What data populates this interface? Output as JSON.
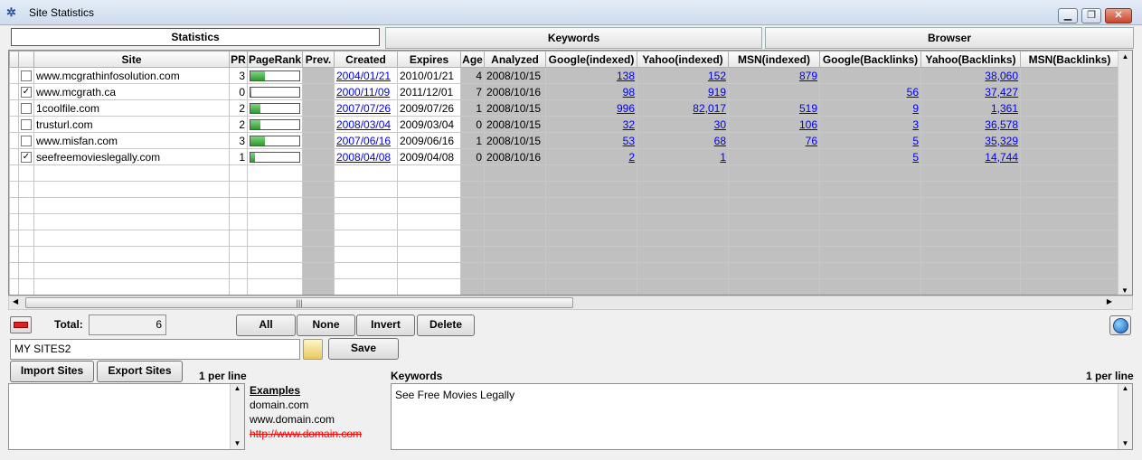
{
  "window": {
    "title": "Site Statistics",
    "minimize": "▁",
    "maximize": "❐",
    "close": "✕"
  },
  "tabs": [
    {
      "label": "Statistics"
    },
    {
      "label": "Keywords"
    },
    {
      "label": "Browser"
    }
  ],
  "grid": {
    "columns": [
      "Site",
      "PR",
      "PageRank",
      "Prev.",
      "Created",
      "Expires",
      "Age",
      "Analyzed",
      "Google(indexed)",
      "Yahoo(indexed)",
      "MSN(indexed)",
      "Google(Backlinks)",
      "Yahoo(Backlinks)",
      "MSN(Backlinks)"
    ],
    "rows": [
      {
        "checked": false,
        "site": "www.mcgrathinfosolution.com",
        "pr": "3",
        "pagerank": 0.3,
        "created": "2004/01/21",
        "expires": "2010/01/21",
        "age": "4",
        "analyzed": "2008/10/15",
        "google_indexed": "138",
        "yahoo_indexed": "152",
        "msn_indexed": "879",
        "google_backlinks": "",
        "yahoo_backlinks": "38,060",
        "msn_backlinks": ""
      },
      {
        "checked": true,
        "site": "www.mcgrath.ca",
        "pr": "0",
        "pagerank": 0.0,
        "created": "2000/11/09",
        "expires": "2011/12/01",
        "age": "7",
        "analyzed": "2008/10/16",
        "google_indexed": "98",
        "yahoo_indexed": "919",
        "msn_indexed": "",
        "google_backlinks": "56",
        "yahoo_backlinks": "37,427",
        "msn_backlinks": ""
      },
      {
        "checked": false,
        "site": "1coolfile.com",
        "pr": "2",
        "pagerank": 0.2,
        "created": "2007/07/26",
        "expires": "2009/07/26",
        "age": "1",
        "analyzed": "2008/10/15",
        "google_indexed": "996",
        "yahoo_indexed": "82,017",
        "msn_indexed": "519",
        "google_backlinks": "9",
        "yahoo_backlinks": "1,361",
        "msn_backlinks": ""
      },
      {
        "checked": false,
        "site": "trusturl.com",
        "pr": "2",
        "pagerank": 0.2,
        "created": "2008/03/04",
        "expires": "2009/03/04",
        "age": "0",
        "analyzed": "2008/10/15",
        "google_indexed": "32",
        "yahoo_indexed": "30",
        "msn_indexed": "106",
        "google_backlinks": "3",
        "yahoo_backlinks": "36,578",
        "msn_backlinks": ""
      },
      {
        "checked": false,
        "site": "www.misfan.com",
        "pr": "3",
        "pagerank": 0.3,
        "created": "2007/06/16",
        "expires": "2009/06/16",
        "age": "1",
        "analyzed": "2008/10/15",
        "google_indexed": "53",
        "yahoo_indexed": "68",
        "msn_indexed": "76",
        "google_backlinks": "5",
        "yahoo_backlinks": "35,329",
        "msn_backlinks": ""
      },
      {
        "checked": true,
        "site": "seefreemovieslegally.com",
        "pr": "1",
        "pagerank": 0.1,
        "created": "2008/04/08",
        "expires": "2009/04/08",
        "age": "0",
        "analyzed": "2008/10/16",
        "google_indexed": "2",
        "yahoo_indexed": "1",
        "msn_indexed": "",
        "google_backlinks": "5",
        "yahoo_backlinks": "14,744",
        "msn_backlinks": ""
      }
    ],
    "empty_rows": 8,
    "hscroll_grip": "|||",
    "scroll_up": "▲",
    "scroll_down": "▼",
    "scroll_left": "◀",
    "scroll_right": "▶"
  },
  "controls": {
    "total_label": "Total:",
    "total_value": "6",
    "buttons": {
      "all": "All",
      "none": "None",
      "invert": "Invert",
      "delete": "Delete",
      "save": "Save",
      "import": "Import Sites",
      "export": "Export Sites"
    },
    "list_name": "MY SITES2"
  },
  "sites_panel": {
    "per_line": "1 per line",
    "examples_title": "Examples",
    "examples": [
      "domain.com",
      "www.domain.com"
    ],
    "example_bad": "http://www.domain.com"
  },
  "keywords_panel": {
    "label": "Keywords",
    "per_line": "1 per line",
    "text": "See Free Movies Legally"
  },
  "colors": {
    "link": "#0000ee",
    "bar_fill": "#2f9c2f",
    "gray_cell": "#c0c0c0",
    "bad_example": "#ff0000"
  }
}
